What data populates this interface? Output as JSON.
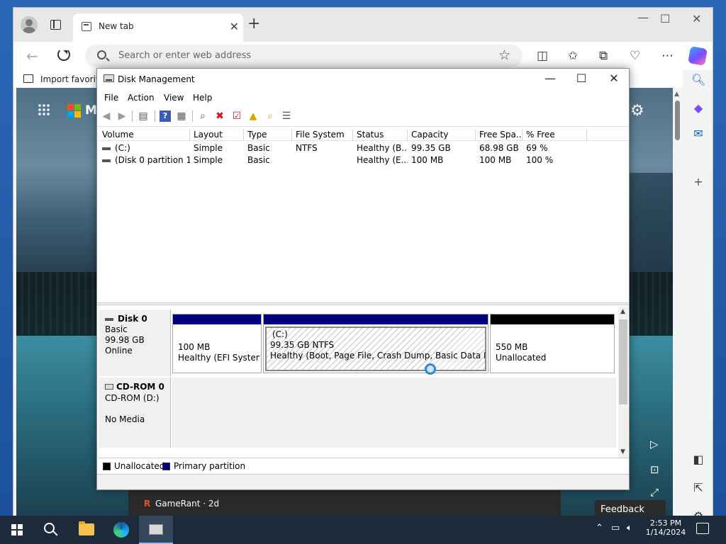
{
  "browser": {
    "tab_title": "New tab",
    "address_placeholder": "Search or enter web address",
    "favorites_label": "Import favorite",
    "ntp": {
      "brand_fragment": "M",
      "news_source": "GameRant",
      "news_age": "2d",
      "news_text": "GameRant · 2d",
      "feedback_label": "Feedback"
    }
  },
  "disk_management": {
    "title": "Disk Management",
    "menu": [
      "File",
      "Action",
      "View",
      "Help"
    ],
    "volume_columns": [
      "Volume",
      "Layout",
      "Type",
      "File System",
      "Status",
      "Capacity",
      "Free Spa...",
      "% Free"
    ],
    "volumes": [
      {
        "volume": "(C:)",
        "layout": "Simple",
        "type": "Basic",
        "file_system": "NTFS",
        "status": "Healthy (B...",
        "capacity": "99.35 GB",
        "free_space": "68.98 GB",
        "percent_free": "69 %"
      },
      {
        "volume": "(Disk 0 partition 1)",
        "layout": "Simple",
        "type": "Basic",
        "file_system": "",
        "status": "Healthy (E...",
        "capacity": "100 MB",
        "free_space": "100 MB",
        "percent_free": "100 %"
      }
    ],
    "disks": [
      {
        "name": "Disk 0",
        "type": "Basic",
        "size": "99.98 GB",
        "state": "Online",
        "partitions": [
          {
            "label": "",
            "size": "100 MB",
            "status": "Healthy (EFI System P",
            "kind": "primary"
          },
          {
            "label": "(C:)",
            "size": "99.35 GB NTFS",
            "status": "Healthy (Boot, Page File, Crash Dump, Basic Data Partition",
            "kind": "primary"
          },
          {
            "label": "",
            "size": "550 MB",
            "status": "Unallocated",
            "kind": "unallocated"
          }
        ]
      },
      {
        "name": "CD-ROM 0",
        "type": "CD-ROM (D:)",
        "size": "",
        "state": "No Media",
        "partitions": []
      }
    ],
    "legend": [
      {
        "label": "Unallocated",
        "color": "#000000"
      },
      {
        "label": "Primary partition",
        "color": "#00007f"
      }
    ]
  },
  "taskbar": {
    "time": "2:53 PM",
    "date": "1/14/2024"
  },
  "colors": {
    "primary_partition": "#00007f",
    "unallocated": "#000000",
    "taskbar": "#1c2a3a"
  }
}
